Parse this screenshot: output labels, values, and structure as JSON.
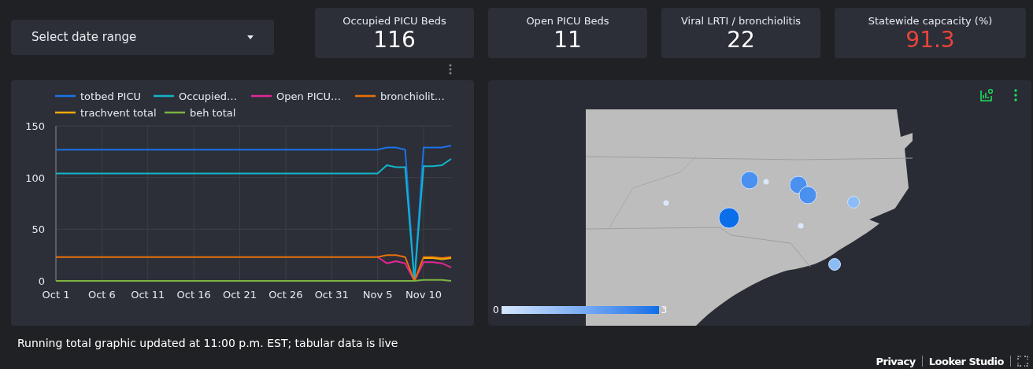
{
  "date_range": {
    "placeholder": "Select date range"
  },
  "scorecards": [
    {
      "label": "Occupied PICU Beds",
      "value": "116",
      "alert": false
    },
    {
      "label": "Open PICU Beds",
      "value": "11",
      "alert": false
    },
    {
      "label": "Viral LRTI / bronchiolitis",
      "value": "22",
      "alert": false
    },
    {
      "label": "Statewide capcacity (%)",
      "value": "91.3",
      "alert": true
    }
  ],
  "line_chart": {
    "chart_data": {
      "type": "line",
      "categories": [
        "Oct 1",
        null,
        null,
        null,
        null,
        "Oct 6",
        null,
        null,
        null,
        null,
        "Oct 11",
        null,
        null,
        null,
        null,
        "Oct 16",
        null,
        null,
        null,
        null,
        "Oct 21",
        null,
        null,
        null,
        null,
        "Oct 26",
        null,
        null,
        null,
        null,
        "Oct 31",
        null,
        null,
        null,
        null,
        "Nov 5",
        null,
        null,
        null,
        null,
        "Nov 10",
        null,
        null,
        null
      ],
      "ylim": [
        0,
        150
      ],
      "grid": true,
      "legend": "top",
      "yticks": [
        0,
        50,
        100,
        150
      ],
      "series": [
        {
          "name": "totbed PICU",
          "color": "#1a73e8",
          "values": [
            127,
            127,
            127,
            127,
            127,
            127,
            127,
            127,
            127,
            127,
            127,
            127,
            127,
            127,
            127,
            127,
            127,
            127,
            127,
            127,
            127,
            127,
            127,
            127,
            127,
            127,
            127,
            127,
            127,
            127,
            127,
            127,
            127,
            127,
            127,
            127,
            129,
            129,
            127,
            0,
            129,
            129,
            129,
            131
          ]
        },
        {
          "name": "Occupied…",
          "color": "#12b5cb",
          "values": [
            104,
            104,
            104,
            104,
            104,
            104,
            104,
            104,
            104,
            104,
            104,
            104,
            104,
            104,
            104,
            104,
            104,
            104,
            104,
            104,
            104,
            104,
            104,
            104,
            104,
            104,
            104,
            104,
            104,
            104,
            104,
            104,
            104,
            104,
            104,
            104,
            112,
            110,
            110,
            0,
            111,
            111,
            112,
            118
          ]
        },
        {
          "name": "Open PICU…",
          "color": "#e52592",
          "values": [
            null,
            null,
            null,
            null,
            null,
            null,
            null,
            null,
            null,
            null,
            null,
            null,
            null,
            null,
            null,
            null,
            null,
            null,
            null,
            null,
            null,
            null,
            null,
            null,
            null,
            null,
            null,
            null,
            null,
            null,
            null,
            null,
            null,
            null,
            null,
            23,
            17,
            19,
            17,
            0,
            18,
            18,
            17,
            13
          ]
        },
        {
          "name": "bronchiolit…",
          "color": "#e8710a",
          "values": [
            23,
            23,
            23,
            23,
            23,
            23,
            23,
            23,
            23,
            23,
            23,
            23,
            23,
            23,
            23,
            23,
            23,
            23,
            23,
            23,
            23,
            23,
            23,
            23,
            23,
            23,
            23,
            23,
            23,
            23,
            23,
            23,
            23,
            23,
            23,
            23,
            25,
            25,
            23,
            0,
            23,
            23,
            22,
            23
          ]
        },
        {
          "name": "trachvent total",
          "color": "#f9ab00",
          "values": [
            null,
            null,
            null,
            null,
            null,
            null,
            null,
            null,
            null,
            null,
            null,
            null,
            null,
            null,
            null,
            null,
            null,
            null,
            null,
            null,
            null,
            null,
            null,
            null,
            null,
            null,
            null,
            null,
            null,
            null,
            null,
            null,
            null,
            null,
            null,
            null,
            null,
            null,
            null,
            null,
            22,
            22,
            21,
            22
          ]
        },
        {
          "name": "beh total",
          "color": "#7cb342",
          "values": [
            0,
            0,
            0,
            0,
            0,
            0,
            0,
            0,
            0,
            0,
            0,
            0,
            0,
            0,
            0,
            0,
            0,
            0,
            0,
            0,
            0,
            0,
            0,
            0,
            0,
            0,
            0,
            0,
            0,
            0,
            0,
            0,
            0,
            0,
            0,
            0,
            0,
            0,
            0,
            0,
            1,
            1,
            1,
            0
          ]
        }
      ]
    }
  },
  "map": {
    "legend_min": "0",
    "legend_max": "3"
  },
  "note": "Running total graphic updated at 11:00 p.m. EST; tabular data is live",
  "footer_links": [
    "Privacy",
    "Looker Studio"
  ]
}
